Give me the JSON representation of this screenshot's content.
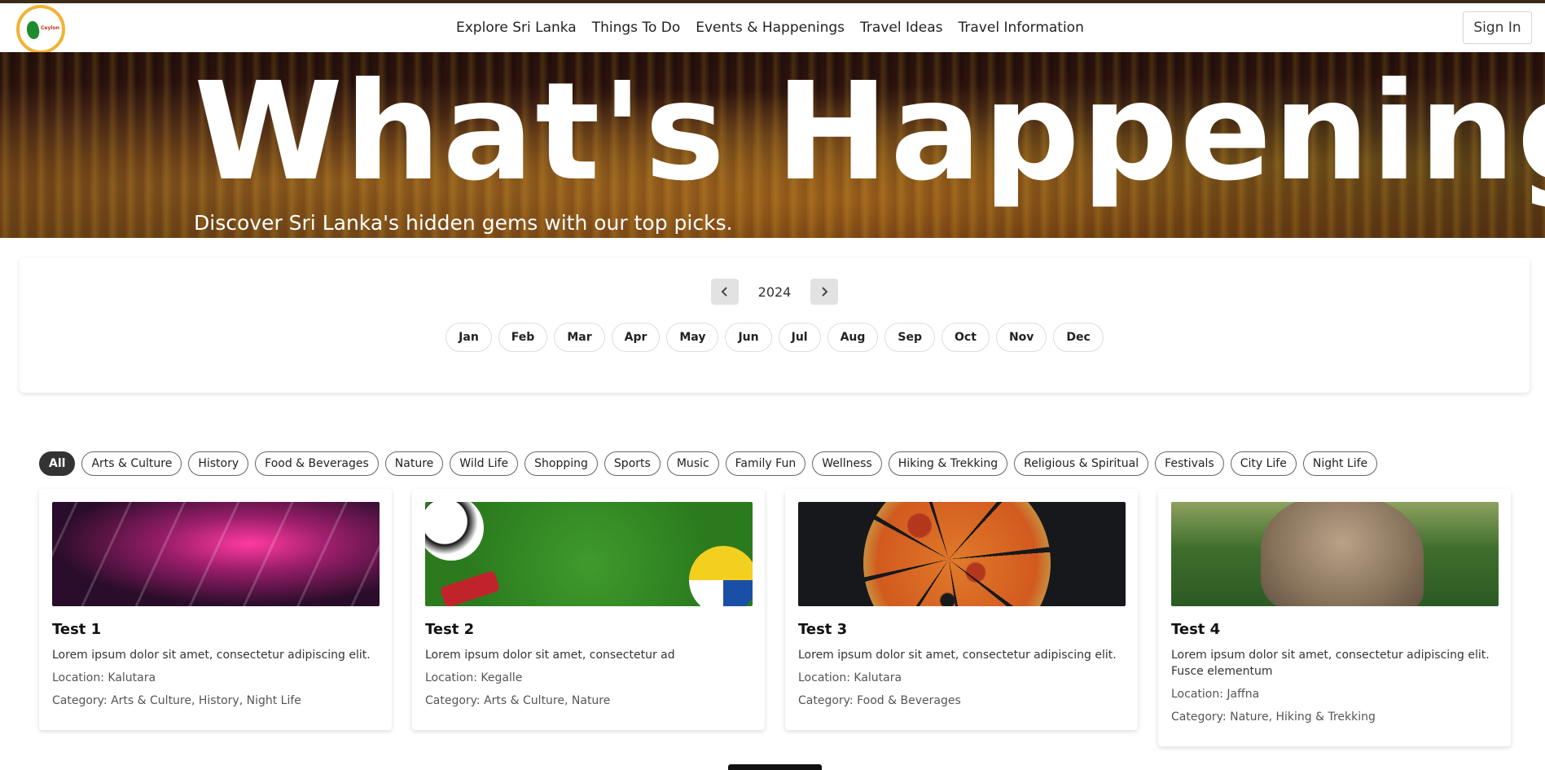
{
  "header": {
    "logo_text": "Ceylon",
    "nav": [
      "Explore Sri Lanka",
      "Things To Do",
      "Events & Happenings",
      "Travel Ideas",
      "Travel Information"
    ],
    "sign_in": "Sign In"
  },
  "hero": {
    "title": "What's Happening",
    "subtitle": "Discover Sri Lanka's hidden gems with our top picks."
  },
  "calendar": {
    "year": "2024",
    "months": [
      "Jan",
      "Feb",
      "Mar",
      "Apr",
      "May",
      "Jun",
      "Jul",
      "Aug",
      "Sep",
      "Oct",
      "Nov",
      "Dec"
    ]
  },
  "filters": {
    "active": "All",
    "chips": [
      "All",
      "Arts & Culture",
      "History",
      "Food & Beverages",
      "Nature",
      "Wild Life",
      "Shopping",
      "Sports",
      "Music",
      "Family Fun",
      "Wellness",
      "Hiking & Trekking",
      "Religious & Spiritual",
      "Festivals",
      "City Life",
      "Night Life"
    ]
  },
  "events": [
    {
      "title": "Test 1",
      "description": "Lorem ipsum dolor sit amet, consectetur adipiscing elit.",
      "location": "Location: Kalutara",
      "category": "Category: Arts & Culture, History, Night Life",
      "image": "concert"
    },
    {
      "title": "Test 2",
      "description": "Lorem ipsum dolor sit amet, consectetur ad",
      "location": "Location: Kegalle",
      "category": "Category: Arts & Culture, Nature",
      "image": "sports"
    },
    {
      "title": "Test 3",
      "description": "Lorem ipsum dolor sit amet, consectetur adipiscing elit.",
      "location": "Location: Kalutara",
      "category": "Category: Food & Beverages",
      "image": "pizza"
    },
    {
      "title": "Test 4",
      "description": "Lorem ipsum dolor sit amet, consectetur adipiscing elit. Fusce elementum",
      "location": "Location: Jaffna",
      "category": "Category: Nature, Hiking & Trekking",
      "image": "rock"
    }
  ],
  "colors": {
    "accent": "#333333",
    "logo_ring": "#f2b233"
  }
}
